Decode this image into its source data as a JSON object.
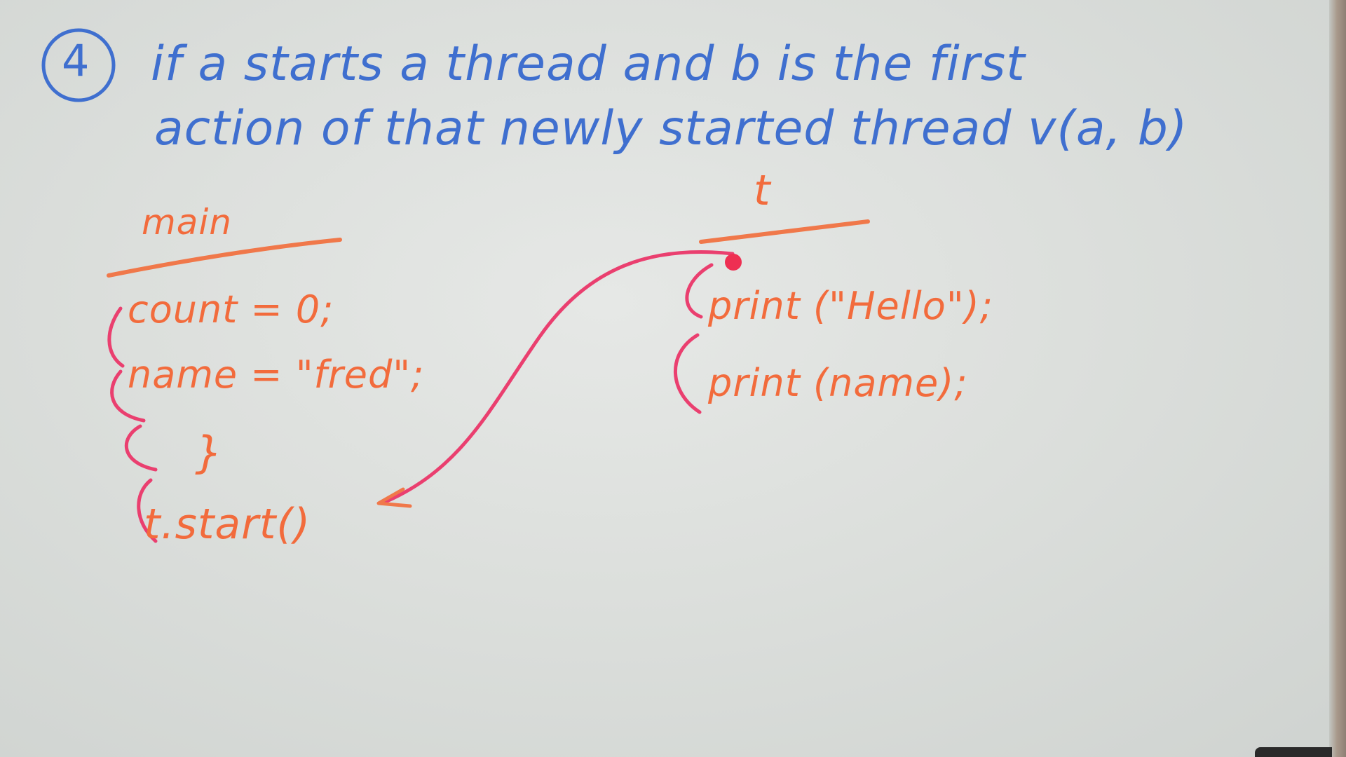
{
  "heading": {
    "number": "4",
    "line1": "if a starts a thread and b is the first",
    "line2": "action of that newly started thread v(a, b)"
  },
  "main_thread": {
    "label": "main",
    "statements": [
      "count = 0;",
      "name = \"fred\";",
      "}",
      "t.start()"
    ]
  },
  "t_thread": {
    "label": "t",
    "statements": [
      "print (\"Hello\");",
      "print (name);"
    ]
  },
  "colors": {
    "board": "#dcdfdc",
    "blue_marker": "#3f6fcf",
    "orange_marker": "#f26b3c",
    "pink_marker": "#ea3f6f"
  }
}
